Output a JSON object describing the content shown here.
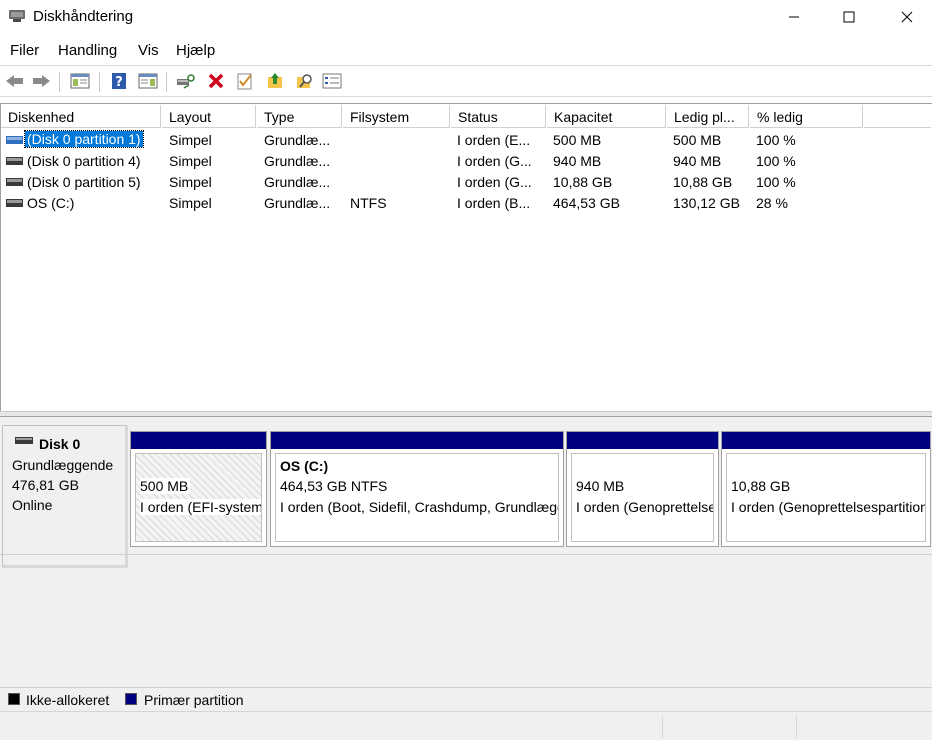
{
  "window": {
    "title": "Diskhåndtering"
  },
  "menu": [
    "Filer",
    "Handling",
    "Vis",
    "Hjælp"
  ],
  "toolbar": {
    "icons": [
      "back-arrow-icon",
      "forward-arrow-icon",
      "console-tree-icon",
      "help-icon",
      "action-pane-icon",
      "connect-drive-icon",
      "delete-icon",
      "properties-check-icon",
      "up-folder-icon",
      "search-folder-icon",
      "list-view-icon"
    ]
  },
  "volume_list": {
    "columns": [
      "Diskenhed",
      "Layout",
      "Type",
      "Filsystem",
      "Status",
      "Kapacitet",
      "Ledig pl...",
      "% ledig"
    ],
    "rows": [
      {
        "volume": "(Disk 0 partition 1)",
        "layout": "Simpel",
        "type": "Grundlæ...",
        "fs": "",
        "status": "I orden (E...",
        "capacity": "500 MB",
        "free": "500 MB",
        "pct": "100 %",
        "selected": true
      },
      {
        "volume": "(Disk 0 partition 4)",
        "layout": "Simpel",
        "type": "Grundlæ...",
        "fs": "",
        "status": "I orden (G...",
        "capacity": "940 MB",
        "free": "940 MB",
        "pct": "100 %"
      },
      {
        "volume": "(Disk 0 partition 5)",
        "layout": "Simpel",
        "type": "Grundlæ...",
        "fs": "",
        "status": "I orden (G...",
        "capacity": "10,88 GB",
        "free": "10,88 GB",
        "pct": "100 %"
      },
      {
        "volume": "OS (C:)",
        "layout": "Simpel",
        "type": "Grundlæ...",
        "fs": "NTFS",
        "status": "I orden (B...",
        "capacity": "464,53 GB",
        "free": "130,12 GB",
        "pct": "28 %"
      }
    ]
  },
  "disk": {
    "name": "Disk 0",
    "type": "Grundlæggende",
    "size": "476,81 GB",
    "state": "Online",
    "partitions": [
      {
        "name": "",
        "size": "500 MB",
        "status": "I orden (EFI-systempartition)"
      },
      {
        "name": "OS  (C:)",
        "size": "464,53 GB NTFS",
        "status": "I orden (Boot, Sidefil, Crashdump, Grundlæggende datapartition)"
      },
      {
        "name": "",
        "size": "940 MB",
        "status": "I orden (Genoprettelsespartition)"
      },
      {
        "name": "",
        "size": "10,88 GB",
        "status": "I orden (Genoprettelsespartition)"
      }
    ]
  },
  "legend": [
    {
      "label": "Ikke-allokeret",
      "color": "#000000"
    },
    {
      "label": "Primær partition",
      "color": "#000080"
    }
  ],
  "colors": {
    "primary_partition_bar": "#000080",
    "selection": "#0078d7",
    "delete_icon": "#d0021b"
  }
}
